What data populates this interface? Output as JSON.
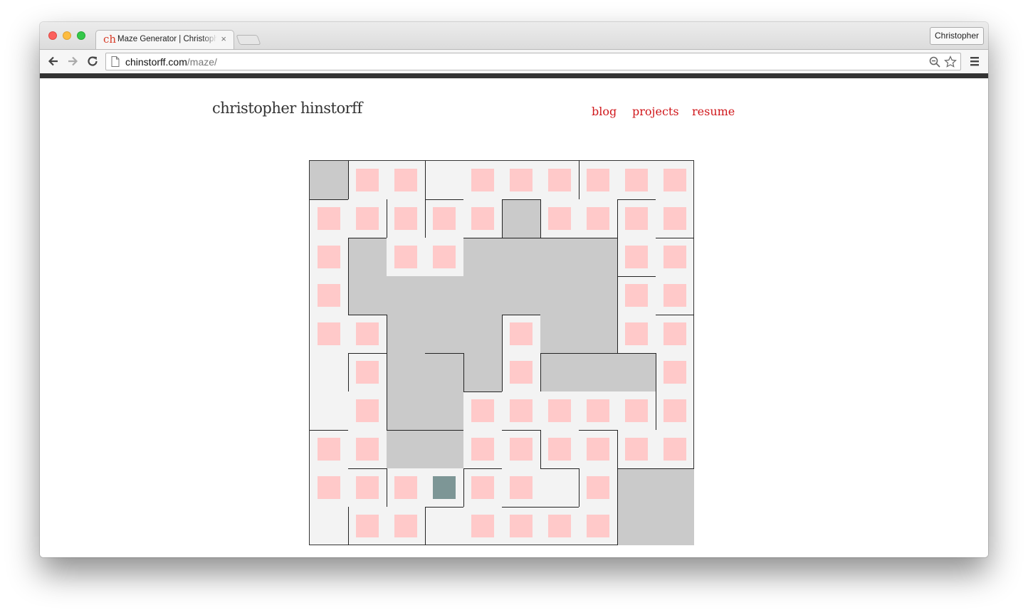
{
  "browser": {
    "tab": {
      "favicon": "ch",
      "title": "Maze Generator | Christopher Hinstorff"
    },
    "profile": "Christopher",
    "url": {
      "host": "chinstorff.com",
      "path": "/maze/"
    }
  },
  "site": {
    "title": "christopher hinstorff",
    "nav": [
      "blog",
      "projects",
      "resume"
    ]
  },
  "maze": {
    "rows": 10,
    "cols": 10,
    "legend": {
      "W": "wall cell",
      "V": "visited cell",
      "C": "current cell",
      ".": "open cell"
    },
    "grid": [
      "WVV.VVVVVV",
      "VVVVVWVVVV",
      "VWVVWWWWVV",
      "VWWWWWWWVV",
      "VVWWWVWWVV",
      ".VWWWVWWWV",
      ".VWWVVVVVV",
      "VVWWVVVVVV",
      "VVVCVV.VWW",
      ".VV.VVVVWW"
    ],
    "colors": {
      "wall": "#cacaca",
      "visited": "#ffc9c9",
      "current": "#7d9696",
      "open": "#f3f3f3"
    }
  }
}
